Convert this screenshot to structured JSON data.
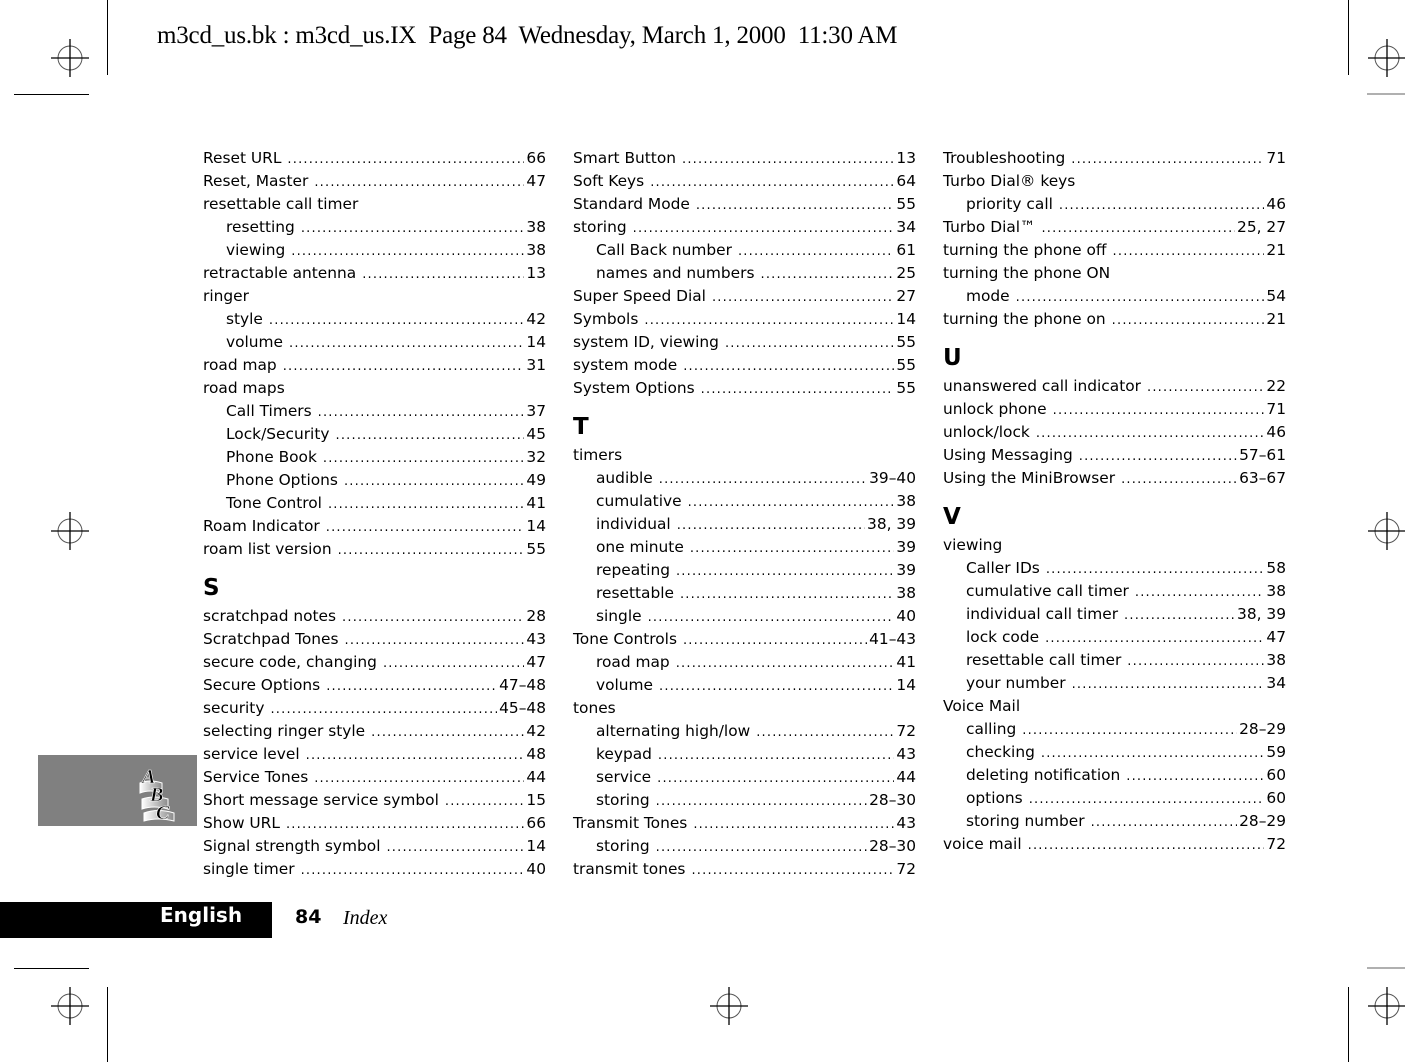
{
  "header": {
    "slug": "m3cd_us.bk : m3cd_us.IX  Page 84  Wednesday, March 1, 2000  11:30 AM"
  },
  "columns": [
    {
      "blocks": [
        {
          "type": "entry",
          "level": 0,
          "term": "Reset URL",
          "pages": "66"
        },
        {
          "type": "entry",
          "level": 0,
          "term": "Reset, Master",
          "pages": "47"
        },
        {
          "type": "entry",
          "level": 0,
          "term": "resettable call timer",
          "pages": ""
        },
        {
          "type": "entry",
          "level": 1,
          "term": "resetting",
          "pages": "38"
        },
        {
          "type": "entry",
          "level": 1,
          "term": "viewing",
          "pages": "38"
        },
        {
          "type": "entry",
          "level": 0,
          "term": "retractable antenna",
          "pages": "13"
        },
        {
          "type": "entry",
          "level": 0,
          "term": "ringer",
          "pages": ""
        },
        {
          "type": "entry",
          "level": 1,
          "term": "style",
          "pages": "42"
        },
        {
          "type": "entry",
          "level": 1,
          "term": "volume",
          "pages": "14"
        },
        {
          "type": "entry",
          "level": 0,
          "term": "road map",
          "pages": "31"
        },
        {
          "type": "entry",
          "level": 0,
          "term": "road maps",
          "pages": ""
        },
        {
          "type": "entry",
          "level": 1,
          "term": "Call Timers",
          "pages": "37"
        },
        {
          "type": "entry",
          "level": 1,
          "term": "Lock/Security",
          "pages": "45"
        },
        {
          "type": "entry",
          "level": 1,
          "term": "Phone Book",
          "pages": "32"
        },
        {
          "type": "entry",
          "level": 1,
          "term": "Phone Options",
          "pages": "49"
        },
        {
          "type": "entry",
          "level": 1,
          "term": "Tone Control",
          "pages": "41"
        },
        {
          "type": "entry",
          "level": 0,
          "term": "Roam Indicator",
          "pages": "14"
        },
        {
          "type": "entry",
          "level": 0,
          "term": "roam list version",
          "pages": "55"
        },
        {
          "type": "heading",
          "letter": "S"
        },
        {
          "type": "entry",
          "level": 0,
          "term": "scratchpad notes",
          "pages": "28"
        },
        {
          "type": "entry",
          "level": 0,
          "term": "Scratchpad Tones",
          "pages": "43"
        },
        {
          "type": "entry",
          "level": 0,
          "term": "secure code, changing",
          "pages": "47"
        },
        {
          "type": "entry",
          "level": 0,
          "term": "Secure Options",
          "pages": "47–48"
        },
        {
          "type": "entry",
          "level": 0,
          "term": "security",
          "pages": "45–48"
        },
        {
          "type": "entry",
          "level": 0,
          "term": "selecting ringer style",
          "pages": "42"
        },
        {
          "type": "entry",
          "level": 0,
          "term": "service level",
          "pages": "48"
        },
        {
          "type": "entry",
          "level": 0,
          "term": "Service Tones",
          "pages": "44"
        },
        {
          "type": "entry",
          "level": 0,
          "term": "Short message service symbol",
          "pages": "15"
        },
        {
          "type": "entry",
          "level": 0,
          "term": "Show URL",
          "pages": "66"
        },
        {
          "type": "entry",
          "level": 0,
          "term": "Signal strength symbol",
          "pages": "14"
        },
        {
          "type": "entry",
          "level": 0,
          "term": "single timer",
          "pages": "40"
        }
      ]
    },
    {
      "blocks": [
        {
          "type": "entry",
          "level": 0,
          "term": "Smart Button",
          "pages": "13"
        },
        {
          "type": "entry",
          "level": 0,
          "term": "Soft Keys",
          "pages": "64"
        },
        {
          "type": "entry",
          "level": 0,
          "term": "Standard Mode",
          "pages": "55"
        },
        {
          "type": "entry",
          "level": 0,
          "term": "storing",
          "pages": "34"
        },
        {
          "type": "entry",
          "level": 1,
          "term": "Call Back number",
          "pages": "61"
        },
        {
          "type": "entry",
          "level": 1,
          "term": "names and numbers",
          "pages": "25"
        },
        {
          "type": "entry",
          "level": 0,
          "term": "Super Speed Dial",
          "pages": "27"
        },
        {
          "type": "entry",
          "level": 0,
          "term": "Symbols",
          "pages": "14"
        },
        {
          "type": "entry",
          "level": 0,
          "term": "system ID, viewing",
          "pages": "55"
        },
        {
          "type": "entry",
          "level": 0,
          "term": "system mode",
          "pages": "55"
        },
        {
          "type": "entry",
          "level": 0,
          "term": "System Options",
          "pages": "55"
        },
        {
          "type": "heading",
          "letter": "T"
        },
        {
          "type": "entry",
          "level": 0,
          "term": "timers",
          "pages": ""
        },
        {
          "type": "entry",
          "level": 1,
          "term": "audible",
          "pages": "39–40"
        },
        {
          "type": "entry",
          "level": 1,
          "term": "cumulative",
          "pages": "38"
        },
        {
          "type": "entry",
          "level": 1,
          "term": "individual",
          "pages": "38, 39"
        },
        {
          "type": "entry",
          "level": 1,
          "term": "one minute",
          "pages": "39"
        },
        {
          "type": "entry",
          "level": 1,
          "term": "repeating",
          "pages": "39"
        },
        {
          "type": "entry",
          "level": 1,
          "term": "resettable",
          "pages": "38"
        },
        {
          "type": "entry",
          "level": 1,
          "term": "single",
          "pages": "40"
        },
        {
          "type": "entry",
          "level": 0,
          "term": "Tone Controls",
          "pages": "41–43"
        },
        {
          "type": "entry",
          "level": 1,
          "term": "road map",
          "pages": "41"
        },
        {
          "type": "entry",
          "level": 1,
          "term": "volume",
          "pages": "14"
        },
        {
          "type": "entry",
          "level": 0,
          "term": "tones",
          "pages": ""
        },
        {
          "type": "entry",
          "level": 1,
          "term": "alternating high/low",
          "pages": "72"
        },
        {
          "type": "entry",
          "level": 1,
          "term": "keypad",
          "pages": "43"
        },
        {
          "type": "entry",
          "level": 1,
          "term": "service",
          "pages": "44"
        },
        {
          "type": "entry",
          "level": 1,
          "term": "storing",
          "pages": "28–30"
        },
        {
          "type": "entry",
          "level": 0,
          "term": "Transmit Tones",
          "pages": "43"
        },
        {
          "type": "entry",
          "level": 1,
          "term": "storing",
          "pages": "28–30"
        },
        {
          "type": "entry",
          "level": 0,
          "term": "transmit tones",
          "pages": "72"
        }
      ]
    },
    {
      "blocks": [
        {
          "type": "entry",
          "level": 0,
          "term": "Troubleshooting",
          "pages": "71"
        },
        {
          "type": "entry",
          "level": 0,
          "term": "Turbo Dial® keys",
          "pages": ""
        },
        {
          "type": "entry",
          "level": 1,
          "term": "priority call",
          "pages": "46"
        },
        {
          "type": "entry",
          "level": 0,
          "term": "Turbo Dial™",
          "pages": "25, 27"
        },
        {
          "type": "entry",
          "level": 0,
          "term": "turning the phone off",
          "pages": "21"
        },
        {
          "type": "entry",
          "level": 0,
          "term": "turning the phone ON",
          "pages": ""
        },
        {
          "type": "entry",
          "level": 1,
          "term": "mode",
          "pages": "54"
        },
        {
          "type": "entry",
          "level": 0,
          "term": "turning the phone on",
          "pages": "21"
        },
        {
          "type": "heading",
          "letter": "U"
        },
        {
          "type": "entry",
          "level": 0,
          "term": "unanswered call indicator",
          "pages": "22"
        },
        {
          "type": "entry",
          "level": 0,
          "term": "unlock phone",
          "pages": "71"
        },
        {
          "type": "entry",
          "level": 0,
          "term": "unlock/lock",
          "pages": "46"
        },
        {
          "type": "entry",
          "level": 0,
          "term": "Using Messaging",
          "pages": "57–61"
        },
        {
          "type": "entry",
          "level": 0,
          "term": "Using the MiniBrowser",
          "pages": "63–67"
        },
        {
          "type": "heading",
          "letter": "V"
        },
        {
          "type": "entry",
          "level": 0,
          "term": "viewing",
          "pages": ""
        },
        {
          "type": "entry",
          "level": 1,
          "term": "Caller IDs",
          "pages": "58"
        },
        {
          "type": "entry",
          "level": 1,
          "term": "cumulative call timer",
          "pages": "38"
        },
        {
          "type": "entry",
          "level": 1,
          "term": "individual call timer",
          "pages": "38, 39"
        },
        {
          "type": "entry",
          "level": 1,
          "term": "lock code",
          "pages": "47"
        },
        {
          "type": "entry",
          "level": 1,
          "term": "resettable call timer",
          "pages": "38"
        },
        {
          "type": "entry",
          "level": 1,
          "term": "your number",
          "pages": "34"
        },
        {
          "type": "entry",
          "level": 0,
          "term": "Voice Mail",
          "pages": ""
        },
        {
          "type": "entry",
          "level": 1,
          "term": "calling",
          "pages": "28–29"
        },
        {
          "type": "entry",
          "level": 1,
          "term": "checking",
          "pages": "59"
        },
        {
          "type": "entry",
          "level": 1,
          "term": "deleting notification",
          "pages": "60"
        },
        {
          "type": "entry",
          "level": 1,
          "term": "options",
          "pages": "60"
        },
        {
          "type": "entry",
          "level": 1,
          "term": "storing number",
          "pages": "28–29"
        },
        {
          "type": "entry",
          "level": 0,
          "term": "voice mail",
          "pages": "72"
        }
      ]
    }
  ],
  "section_tab": {
    "icon": "abc-index-icon",
    "letters": [
      "A",
      "B",
      "C"
    ],
    "color": "#808080"
  },
  "footer": {
    "language": "English",
    "page_number": "84",
    "section": "Index"
  }
}
